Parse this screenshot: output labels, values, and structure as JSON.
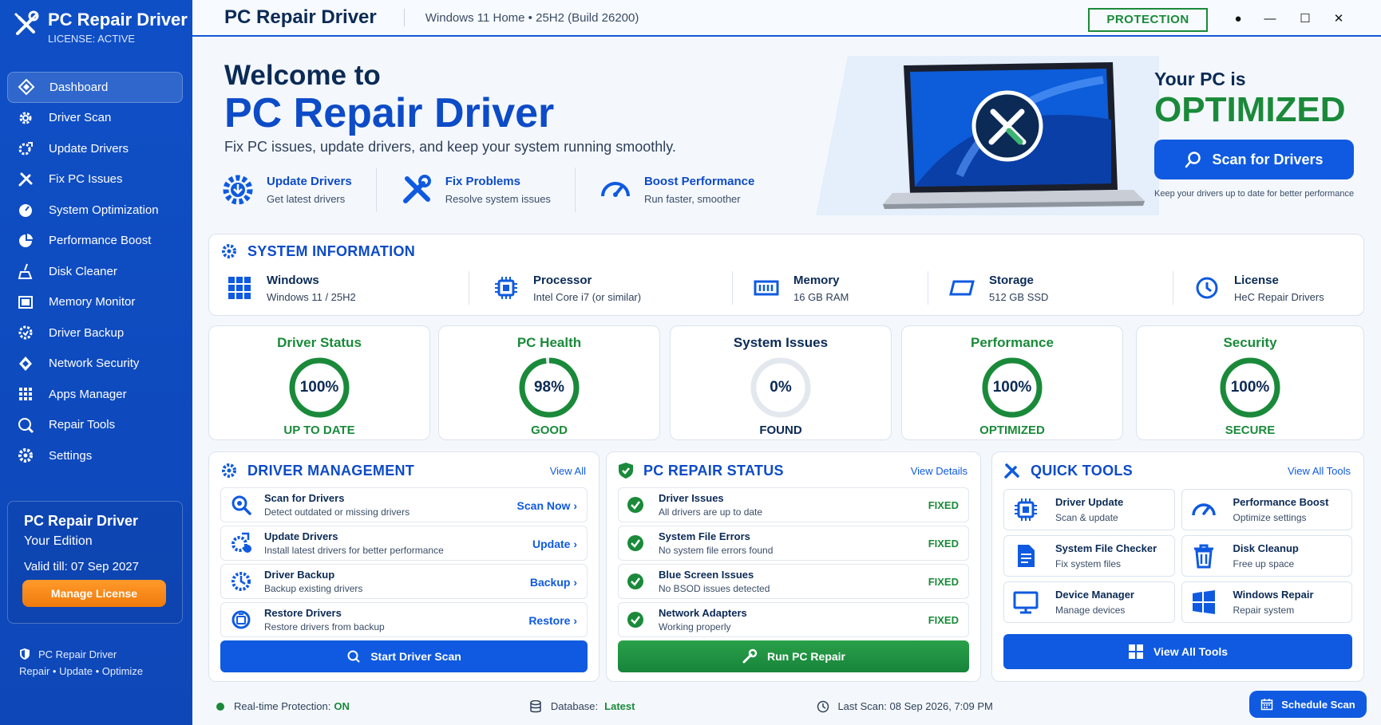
{
  "app": {
    "name": "PC Repair Driver",
    "license": "LICENSE: ACTIVE"
  },
  "sidebar": {
    "items": [
      {
        "label": "Dashboard",
        "icon": "dashboard-icon",
        "active": true
      },
      {
        "label": "Driver Scan",
        "icon": "gear-icon"
      },
      {
        "label": "Update Drivers",
        "icon": "update-gear-icon"
      },
      {
        "label": "Fix PC Issues",
        "icon": "wrench-icon"
      },
      {
        "label": "System Optimization",
        "icon": "speedometer-icon"
      },
      {
        "label": "Performance Boost",
        "icon": "pie-icon"
      },
      {
        "label": "Disk Cleaner",
        "icon": "broom-icon"
      },
      {
        "label": "Memory Monitor",
        "icon": "memory-icon"
      },
      {
        "label": "Driver Backup",
        "icon": "backup-icon"
      },
      {
        "label": "Network Security",
        "icon": "network-icon"
      },
      {
        "label": "Apps Manager",
        "icon": "apps-grid-icon"
      },
      {
        "label": "Repair Tools",
        "icon": "repair-tools-icon"
      },
      {
        "label": "Settings",
        "icon": "settings-icon"
      }
    ],
    "edition": {
      "title": "PC Repair Driver",
      "subtitle": "Your Edition",
      "valid": "Valid till: 07 Sep 2027",
      "button": "Manage License"
    },
    "footer": {
      "name": "PC Repair Driver",
      "tagline": "Repair  •  Update  •  Optimize"
    }
  },
  "topbar": {
    "title": "PC Repair Driver",
    "os": "Windows 11 Home  •  25H2  (Build 26200)",
    "protection": "PROTECTION"
  },
  "hero": {
    "welcome": "Welcome to",
    "title": "PC Repair Driver",
    "tagline": "Fix PC issues, update drivers, and keep your system running smoothly.",
    "features": [
      {
        "title": "Update Drivers",
        "sub": "Get latest drivers"
      },
      {
        "title": "Fix Problems",
        "sub": "Resolve system issues"
      },
      {
        "title": "Boost Performance",
        "sub": "Run faster, smoother"
      }
    ],
    "status_line1": "Your PC is",
    "status_line2": "OPTIMIZED",
    "scan_button": "Scan for Drivers",
    "scan_note": "Keep your drivers up to date for better performance"
  },
  "system_info": {
    "title": "SYSTEM INFORMATION",
    "items": [
      {
        "label": "Windows",
        "value": "Windows 11 / 25H2"
      },
      {
        "label": "Processor",
        "value": "Intel Core i7 (or similar)"
      },
      {
        "label": "Memory",
        "value": "16 GB RAM"
      },
      {
        "label": "Storage",
        "value": "512 GB SSD"
      },
      {
        "label": "License",
        "value": "HeC Repair Drivers"
      }
    ]
  },
  "stats": [
    {
      "title": "Driver Status",
      "value": "100%",
      "percent": 100,
      "status": "UP TO DATE",
      "color": "#1a8a3a",
      "title_color": "#1a8a3a"
    },
    {
      "title": "PC Health",
      "value": "98%",
      "percent": 98,
      "status": "GOOD",
      "color": "#1a8a3a",
      "title_color": "#1a8a3a"
    },
    {
      "title": "System Issues",
      "value": "0%",
      "percent": 0,
      "status": "FOUND",
      "color": "#1a8a3a",
      "title_color": "#0b2a55"
    },
    {
      "title": "Performance",
      "value": "100%",
      "percent": 100,
      "status": "OPTIMIZED",
      "color": "#1a8a3a",
      "title_color": "#1a8a3a"
    },
    {
      "title": "Security",
      "value": "100%",
      "percent": 100,
      "status": "SECURE",
      "color": "#1a8a3a",
      "title_color": "#1a8a3a"
    }
  ],
  "driver_mgmt": {
    "title": "DRIVER MANAGEMENT",
    "link": "View All",
    "rows": [
      {
        "title": "Scan for Drivers",
        "sub": "Detect outdated or missing drivers",
        "action": "Scan Now  ›"
      },
      {
        "title": "Update Drivers",
        "sub": "Install latest drivers for better performance",
        "action": "Update  ›"
      },
      {
        "title": "Driver Backup",
        "sub": "Backup existing drivers",
        "action": "Backup  ›"
      },
      {
        "title": "Restore Drivers",
        "sub": "Restore drivers from backup",
        "action": "Restore  ›"
      }
    ],
    "button": "Start Driver Scan"
  },
  "repair_status": {
    "title": "PC REPAIR STATUS",
    "link": "View Details",
    "rows": [
      {
        "title": "Driver Issues",
        "sub": "All drivers are up to date",
        "status": "FIXED"
      },
      {
        "title": "System File Errors",
        "sub": "No system file errors found",
        "status": "FIXED"
      },
      {
        "title": "Blue Screen Issues",
        "sub": "No BSOD issues detected",
        "status": "FIXED"
      },
      {
        "title": "Network Adapters",
        "sub": "Working properly",
        "status": "FIXED"
      }
    ],
    "button": "Run PC Repair"
  },
  "quick_tools": {
    "title": "QUICK TOOLS",
    "link": "View All Tools",
    "tools": [
      {
        "title": "Driver Update",
        "sub": "Scan & update"
      },
      {
        "title": "Performance Boost",
        "sub": "Optimize settings"
      },
      {
        "title": "System File Checker",
        "sub": "Fix system files"
      },
      {
        "title": "Disk Cleanup",
        "sub": "Free up space"
      },
      {
        "title": "Device Manager",
        "sub": "Manage devices"
      },
      {
        "title": "Windows Repair",
        "sub": "Repair system"
      }
    ],
    "button": "View All Tools"
  },
  "statusbar": {
    "protection_label": "Real-time Protection:",
    "protection_value": "ON",
    "database_label": "Database:",
    "database_value": "Latest",
    "last_scan": "Last Scan: 08 Sep 2026, 7:09 PM",
    "schedule_button": "Schedule Scan"
  },
  "colors": {
    "brand": "#0f5ae0",
    "sidebar": "#0f4fc6",
    "success": "#1a8a3a",
    "accent": "#f07a0c"
  }
}
